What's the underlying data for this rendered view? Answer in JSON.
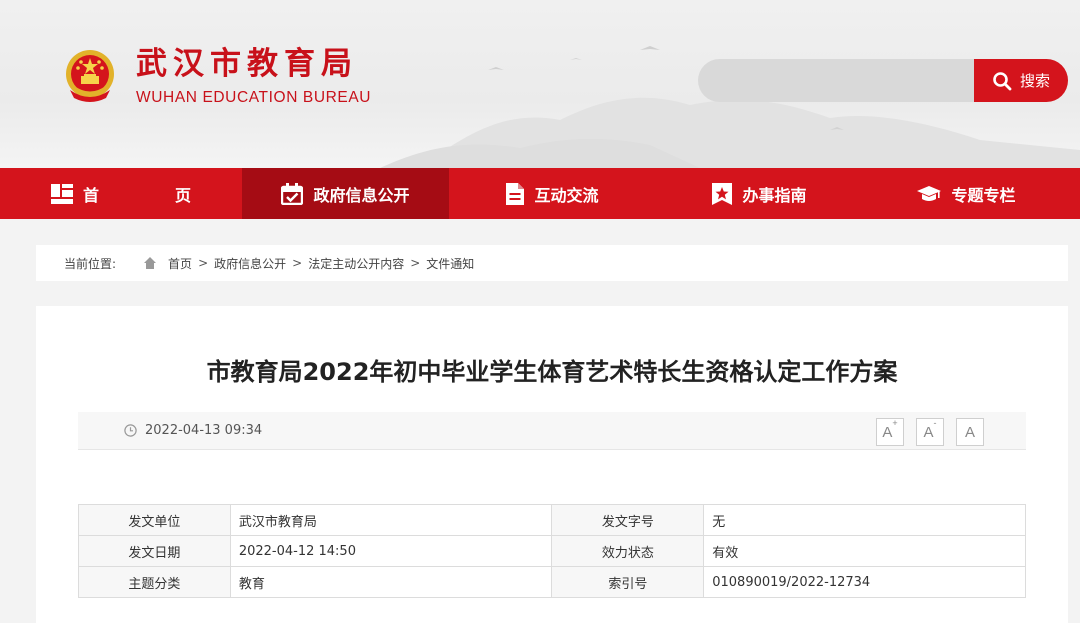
{
  "header": {
    "brand_cn": "武汉市教育局",
    "brand_en": "WUHAN EDUCATION BUREAU",
    "search_placeholder": "",
    "search_label": "搜索",
    "accent_color": "#d4141c"
  },
  "nav": {
    "items": [
      {
        "label": "首　页",
        "icon": "grid-icon"
      },
      {
        "label": "政府信息公开",
        "icon": "calendar-check-icon",
        "active": true
      },
      {
        "label": "互动交流",
        "icon": "document-icon"
      },
      {
        "label": "办事指南",
        "icon": "star-badge-icon"
      },
      {
        "label": "专题专栏",
        "icon": "graduation-cap-icon"
      }
    ]
  },
  "breadcrumb": {
    "prefix": "当前位置:",
    "items": [
      "首页",
      "政府信息公开",
      "法定主动公开内容",
      "文件通知"
    ],
    "separator": ">"
  },
  "article": {
    "title": "市教育局2022年初中毕业学生体育艺术特长生资格认定工作方案",
    "date": "2022-04-13 09:34",
    "font_buttons": [
      "A+",
      "A-",
      "A"
    ]
  },
  "info_table": {
    "rows": [
      [
        "发文单位",
        "武汉市教育局",
        "发文字号",
        "无"
      ],
      [
        "发文日期",
        "2022-04-12 14:50",
        "效力状态",
        "有效"
      ],
      [
        "主题分类",
        "教育",
        "索引号",
        "010890019/2022-12734"
      ]
    ]
  }
}
